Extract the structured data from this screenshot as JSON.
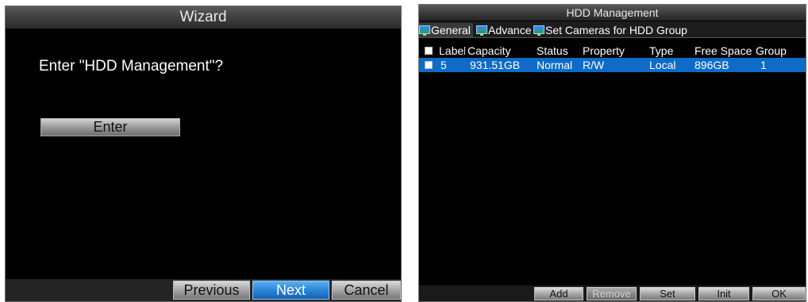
{
  "wizard": {
    "title": "Wizard",
    "prompt": "Enter \"HDD Management\"?",
    "enter_label": "Enter",
    "buttons": {
      "previous": "Previous",
      "next": "Next",
      "cancel": "Cancel"
    }
  },
  "hdd": {
    "title": "HDD Management",
    "tabs": [
      {
        "label": "General",
        "icon": "monitor-icon"
      },
      {
        "label": "Advance",
        "icon": "monitor-icon"
      },
      {
        "label": "Set Cameras for HDD Group",
        "icon": "monitor-icon"
      }
    ],
    "columns": [
      "Label",
      "Capacity",
      "Status",
      "Property",
      "Type",
      "Free Space",
      "Group"
    ],
    "rows": [
      {
        "label": "5",
        "capacity": "931.51GB",
        "status": "Normal",
        "property": "R/W",
        "type": "Local",
        "free_space": "896GB",
        "group": "1"
      }
    ],
    "buttons": {
      "add": "Add",
      "remove": "Remove",
      "set": "Set",
      "init": "Init",
      "ok": "OK"
    }
  },
  "colors": {
    "selected_row": "#0e6bc6",
    "active_button": "#2a86d8",
    "background": "#000000"
  }
}
